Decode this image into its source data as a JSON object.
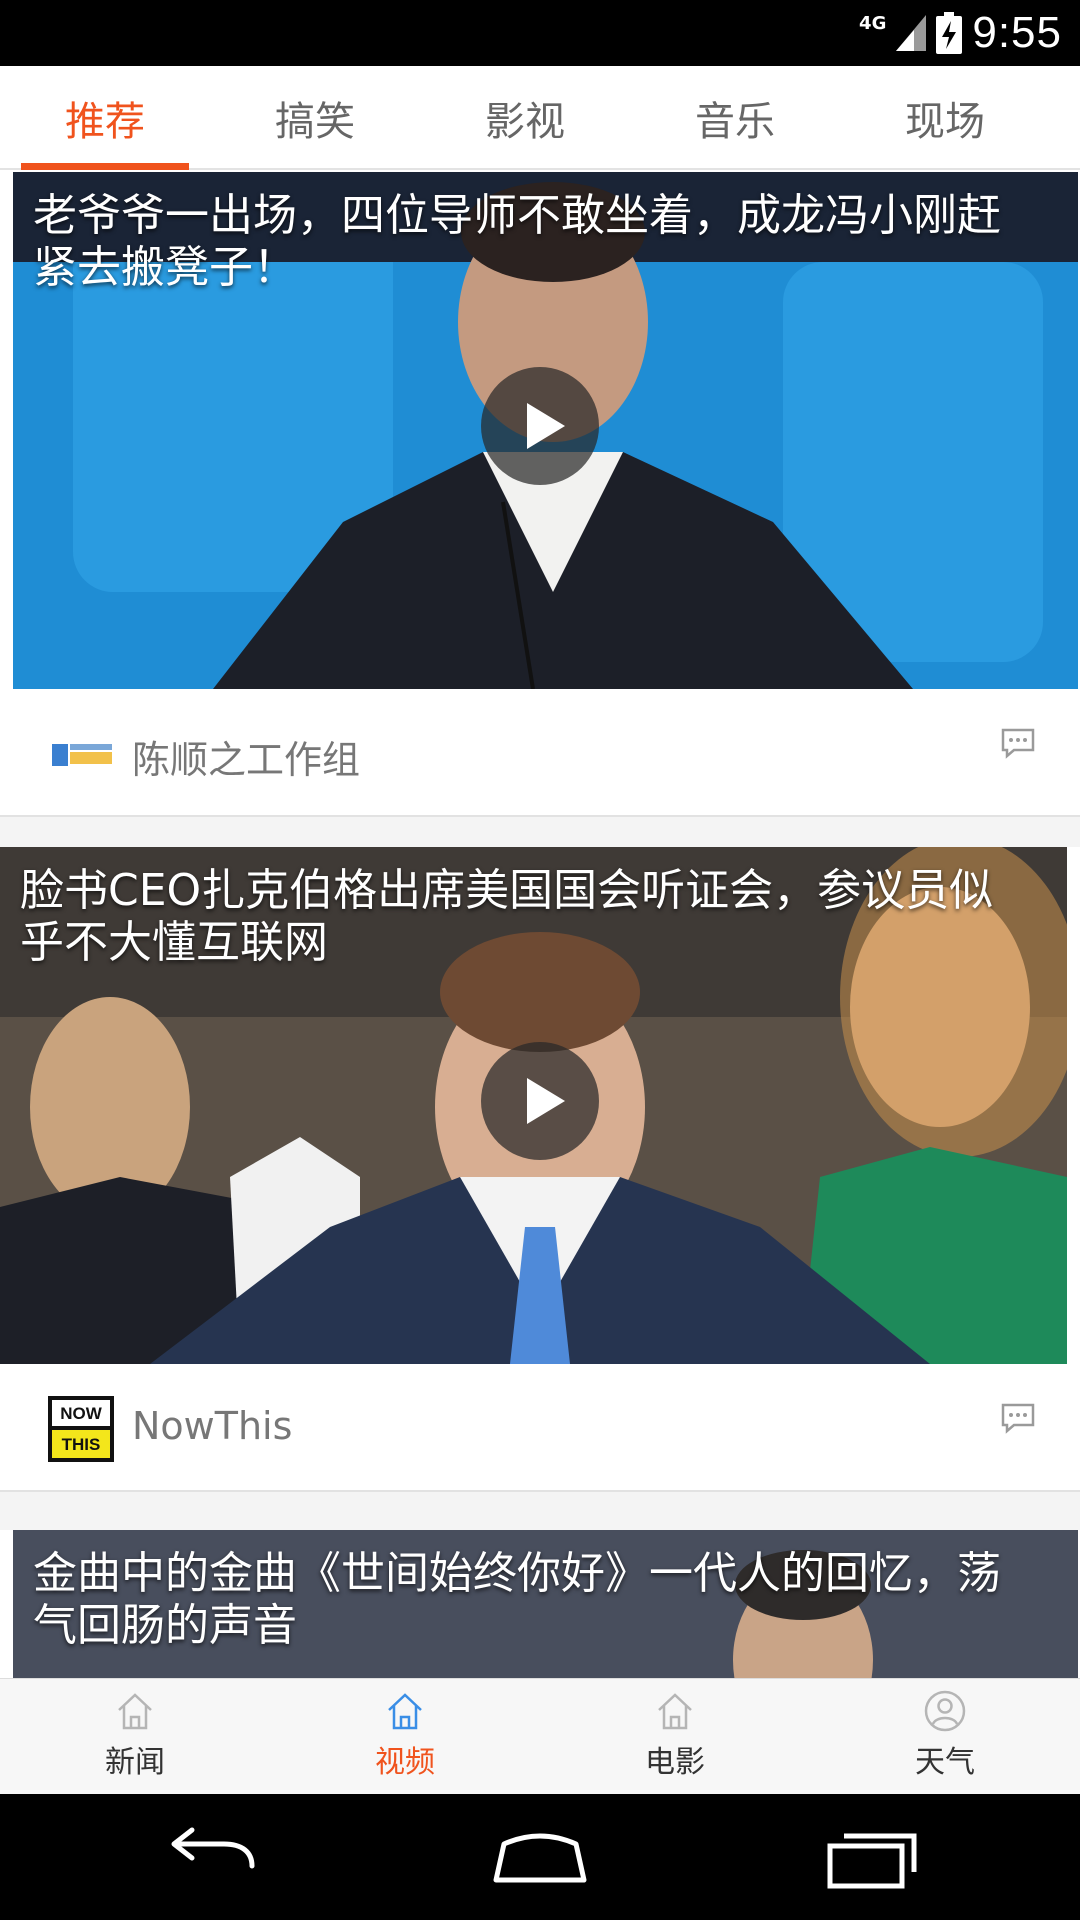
{
  "status_bar": {
    "network": "4G",
    "time": "9:55"
  },
  "tabs": [
    {
      "label": "推荐",
      "active": true
    },
    {
      "label": "搞笑",
      "active": false
    },
    {
      "label": "影视",
      "active": false
    },
    {
      "label": "音乐",
      "active": false
    },
    {
      "label": "现场",
      "active": false
    }
  ],
  "feed": [
    {
      "title": "老爷爷一出场，四位导师不敢坐着，成龙冯小刚赶紧去搬凳子！",
      "author": "陈顺之工作组",
      "thumb_colors": {
        "bg": "#1f8dd4",
        "suit": "#1c1f28"
      }
    },
    {
      "title": "脸书CEO扎克伯格出席美国国会听证会，参议员似乎不大懂互联网",
      "author": "NowThis",
      "logo_text": [
        "NOW",
        "THIS"
      ],
      "thumb_colors": {
        "bg": "#5a5046",
        "suit": "#263450"
      }
    },
    {
      "title": "金曲中的金曲《世间始终你好》一代人的回忆，荡气回肠的声音",
      "author": "",
      "thumb_colors": {
        "bg": "#3d4350"
      }
    }
  ],
  "bottom_nav": [
    {
      "label": "新闻",
      "icon": "home-icon",
      "active": false
    },
    {
      "label": "视频",
      "icon": "home-icon",
      "active": true
    },
    {
      "label": "电影",
      "icon": "home-icon",
      "active": false
    },
    {
      "label": "天气",
      "icon": "person-icon",
      "active": false
    }
  ],
  "colors": {
    "accent": "#f0531d",
    "active_icon": "#3a8ee6"
  }
}
